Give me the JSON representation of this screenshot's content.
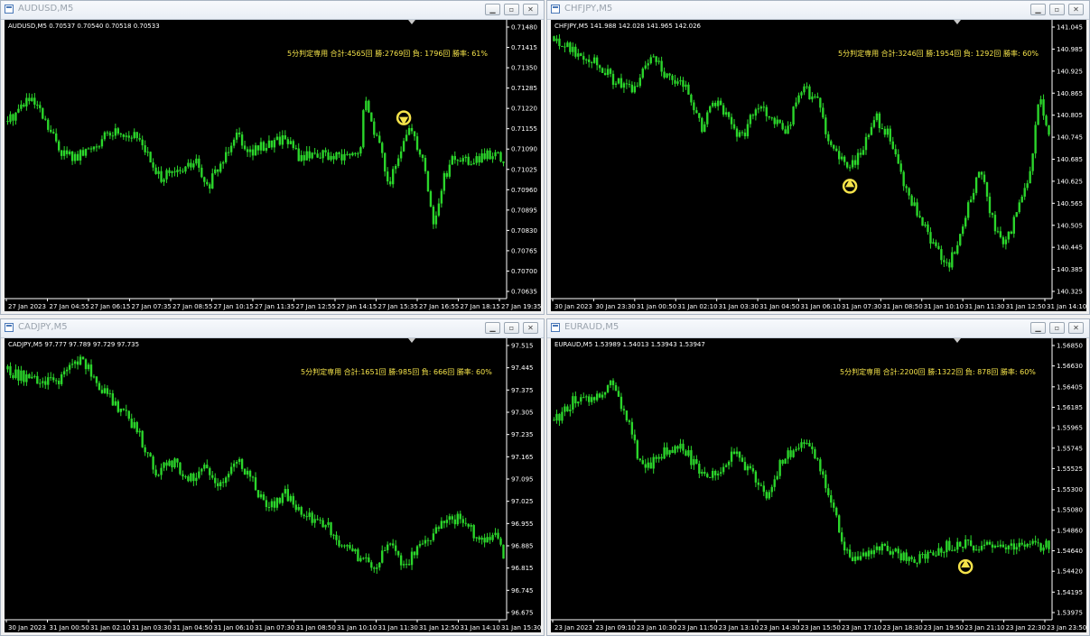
{
  "colors": {
    "candle": "#2bd62b",
    "signal": "#f5e34a",
    "axis": "#ffffff",
    "background": "#000000"
  },
  "windows": [
    {
      "title": "AUDUSD,M5",
      "symbol_line": "AUDUSD,M5  0.70537 0.70540 0.70518 0.70533",
      "stats": "5分判定専用  合計:4565回  勝:2769回 負: 1796回 勝率: 61%",
      "arrow": {
        "direction": "down",
        "x_index": 147
      },
      "y_labels": [
        "0.71480",
        "0.71415",
        "0.71350",
        "0.71285",
        "0.71220",
        "0.71155",
        "0.71090",
        "0.71025",
        "0.70960",
        "0.70895",
        "0.70830",
        "0.70765",
        "0.70700",
        "0.70635"
      ],
      "x_labels": [
        "27 Jan 2023",
        "27 Jan 04:55",
        "27 Jan 06:15",
        "27 Jan 07:35",
        "27 Jan 08:55",
        "27 Jan 10:15",
        "27 Jan 11:35",
        "27 Jan 12:55",
        "27 Jan 14:15",
        "27 Jan 15:35",
        "27 Jan 16:55",
        "27 Jan 18:15",
        "27 Jan 19:35"
      ],
      "path": [
        [
          0,
          0.7118
        ],
        [
          0.04,
          0.7125
        ],
        [
          0.06,
          0.7122
        ],
        [
          0.08,
          0.7116
        ],
        [
          0.11,
          0.7108
        ],
        [
          0.14,
          0.7106
        ],
        [
          0.18,
          0.7111
        ],
        [
          0.22,
          0.7115
        ],
        [
          0.27,
          0.7112
        ],
        [
          0.3,
          0.71
        ],
        [
          0.34,
          0.7101
        ],
        [
          0.38,
          0.7105
        ],
        [
          0.4,
          0.7096
        ],
        [
          0.43,
          0.7104
        ],
        [
          0.46,
          0.7115
        ],
        [
          0.49,
          0.7108
        ],
        [
          0.53,
          0.7111
        ],
        [
          0.56,
          0.7113
        ],
        [
          0.59,
          0.7106
        ],
        [
          0.62,
          0.7108
        ],
        [
          0.66,
          0.7106
        ],
        [
          0.71,
          0.7107
        ],
        [
          0.72,
          0.7125
        ],
        [
          0.75,
          0.711
        ],
        [
          0.77,
          0.7098
        ],
        [
          0.79,
          0.7106
        ],
        [
          0.81,
          0.7117
        ],
        [
          0.84,
          0.7105
        ],
        [
          0.86,
          0.7084
        ],
        [
          0.88,
          0.71
        ],
        [
          0.9,
          0.7106
        ],
        [
          0.93,
          0.7105
        ],
        [
          0.96,
          0.7106
        ],
        [
          0.98,
          0.7108
        ],
        [
          1,
          0.7104
        ]
      ]
    },
    {
      "title": "CHFJPY,M5",
      "symbol_line": "CHFJPY,M5  141.988 142.028 141.965 142.026",
      "stats": "5分判定専用  合計:3246回  勝:1954回 負: 1292回 勝率: 60%",
      "arrow": {
        "direction": "up",
        "x_index": 110
      },
      "y_labels": [
        "141.045",
        "140.985",
        "140.925",
        "140.865",
        "140.805",
        "140.745",
        "140.685",
        "140.625",
        "140.565",
        "140.505",
        "140.445",
        "140.385",
        "140.325"
      ],
      "x_labels": [
        "30 Jan 2023",
        "30 Jan 23:30",
        "31 Jan 00:50",
        "31 Jan 02:10",
        "31 Jan 03:30",
        "31 Jan 04:50",
        "31 Jan 06:10",
        "31 Jan 07:30",
        "31 Jan 08:50",
        "31 Jan 10:10",
        "31 Jan 11:30",
        "31 Jan 12:50",
        "31 Jan 14:10"
      ],
      "path": [
        [
          0,
          141.02
        ],
        [
          0.04,
          140.98
        ],
        [
          0.08,
          140.96
        ],
        [
          0.12,
          140.9
        ],
        [
          0.16,
          140.87
        ],
        [
          0.2,
          140.98
        ],
        [
          0.23,
          140.9
        ],
        [
          0.27,
          140.88
        ],
        [
          0.3,
          140.76
        ],
        [
          0.32,
          140.85
        ],
        [
          0.35,
          140.8
        ],
        [
          0.38,
          140.74
        ],
        [
          0.41,
          140.84
        ],
        [
          0.44,
          140.8
        ],
        [
          0.47,
          140.76
        ],
        [
          0.5,
          140.88
        ],
        [
          0.53,
          140.85
        ],
        [
          0.56,
          140.72
        ],
        [
          0.59,
          140.66
        ],
        [
          0.62,
          140.7
        ],
        [
          0.65,
          140.8
        ],
        [
          0.68,
          140.74
        ],
        [
          0.71,
          140.6
        ],
        [
          0.74,
          140.52
        ],
        [
          0.77,
          140.44
        ],
        [
          0.8,
          140.4
        ],
        [
          0.83,
          140.52
        ],
        [
          0.86,
          140.66
        ],
        [
          0.89,
          140.5
        ],
        [
          0.91,
          140.44
        ],
        [
          0.94,
          140.56
        ],
        [
          0.96,
          140.62
        ],
        [
          0.98,
          140.86
        ],
        [
          1,
          140.74
        ]
      ]
    },
    {
      "title": "CADJPY,M5",
      "symbol_line": "CADJPY,M5  97.777 97.789 97.729 97.735",
      "stats": "5分判定専用  合計:1651回  勝:985回 負: 666回 勝率: 60%",
      "arrow": null,
      "y_labels": [
        "97.515",
        "97.445",
        "97.375",
        "97.305",
        "97.235",
        "97.165",
        "97.095",
        "97.025",
        "96.955",
        "96.885",
        "96.815",
        "96.745",
        "96.675"
      ],
      "x_labels": [
        "30 Jan 2023",
        "31 Jan 00:50",
        "31 Jan 02:10",
        "31 Jan 03:30",
        "31 Jan 04:50",
        "31 Jan 06:10",
        "31 Jan 07:30",
        "31 Jan 08:50",
        "31 Jan 10:10",
        "31 Jan 11:30",
        "31 Jan 12:50",
        "31 Jan 14:10",
        "31 Jan 15:30"
      ],
      "path": [
        [
          0,
          97.44
        ],
        [
          0.05,
          97.4
        ],
        [
          0.1,
          97.4
        ],
        [
          0.15,
          97.48
        ],
        [
          0.18,
          97.4
        ],
        [
          0.22,
          97.33
        ],
        [
          0.26,
          97.25
        ],
        [
          0.3,
          97.12
        ],
        [
          0.33,
          97.15
        ],
        [
          0.37,
          97.1
        ],
        [
          0.4,
          97.13
        ],
        [
          0.43,
          97.08
        ],
        [
          0.46,
          97.16
        ],
        [
          0.49,
          97.1
        ],
        [
          0.52,
          97.0
        ],
        [
          0.56,
          97.05
        ],
        [
          0.6,
          96.98
        ],
        [
          0.64,
          96.96
        ],
        [
          0.67,
          96.88
        ],
        [
          0.7,
          96.86
        ],
        [
          0.74,
          96.82
        ],
        [
          0.77,
          96.9
        ],
        [
          0.8,
          96.82
        ],
        [
          0.84,
          96.9
        ],
        [
          0.88,
          96.96
        ],
        [
          0.92,
          96.97
        ],
        [
          0.95,
          96.9
        ],
        [
          0.98,
          96.92
        ],
        [
          1,
          96.86
        ]
      ]
    },
    {
      "title": "EURAUD,M5",
      "symbol_line": "EURAUD,M5  1.53989 1.54013 1.53943 1.53947",
      "stats": "5分判定専用  合計:2200回  勝:1322回 負: 878回 勝率: 60%",
      "arrow": {
        "direction": "up",
        "x_index": 153
      },
      "y_labels": [
        "1.56850",
        "1.56630",
        "1.56405",
        "1.56185",
        "1.55965",
        "1.55745",
        "1.55525",
        "1.55300",
        "1.55080",
        "1.54860",
        "1.54640",
        "1.54420",
        "1.54195",
        "1.53975"
      ],
      "x_labels": [
        "23 Jan 2023",
        "23 Jan 09:10",
        "23 Jan 10:30",
        "23 Jan 11:50",
        "23 Jan 13:10",
        "23 Jan 14:30",
        "23 Jan 15:50",
        "23 Jan 17:10",
        "23 Jan 18:30",
        "23 Jan 19:50",
        "23 Jan 21:10",
        "23 Jan 22:30",
        "23 Jan 23:50"
      ],
      "path": [
        [
          0,
          1.5605
        ],
        [
          0.04,
          1.5625
        ],
        [
          0.08,
          1.563
        ],
        [
          0.12,
          1.5645
        ],
        [
          0.15,
          1.56
        ],
        [
          0.18,
          1.555
        ],
        [
          0.22,
          1.557
        ],
        [
          0.26,
          1.5575
        ],
        [
          0.3,
          1.5545
        ],
        [
          0.33,
          1.555
        ],
        [
          0.37,
          1.557
        ],
        [
          0.4,
          1.5545
        ],
        [
          0.43,
          1.5525
        ],
        [
          0.46,
          1.556
        ],
        [
          0.5,
          1.558
        ],
        [
          0.53,
          1.5565
        ],
        [
          0.56,
          1.552
        ],
        [
          0.59,
          1.546
        ],
        [
          0.61,
          1.5455
        ],
        [
          0.65,
          1.5468
        ],
        [
          0.7,
          1.546
        ],
        [
          0.74,
          1.5455
        ],
        [
          0.78,
          1.5468
        ],
        [
          0.82,
          1.5472
        ],
        [
          0.86,
          1.5466
        ],
        [
          0.9,
          1.547
        ],
        [
          0.94,
          1.5472
        ],
        [
          0.98,
          1.547
        ],
        [
          1,
          1.5468
        ]
      ]
    }
  ]
}
